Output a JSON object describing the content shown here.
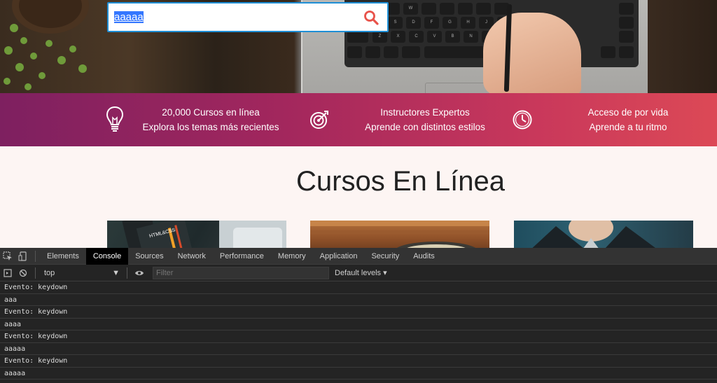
{
  "search": {
    "value": "aaaaa"
  },
  "features": [
    {
      "icon": "lightbulb-icon",
      "line1": "20,000 Cursos en línea",
      "line2": "Explora los temas más recientes"
    },
    {
      "icon": "target-icon",
      "line1": "Instructores Expertos",
      "line2": "Aprende con distintos estilos"
    },
    {
      "icon": "clock-icon",
      "line1": "Acceso de por vida",
      "line2": "Aprende a tu ritmo"
    }
  ],
  "courses": {
    "title": "Cursos En Línea",
    "card1_text": "HTML&CSS"
  },
  "devtools": {
    "tabs": [
      "Elements",
      "Console",
      "Sources",
      "Network",
      "Performance",
      "Memory",
      "Application",
      "Security",
      "Audits"
    ],
    "active_tab": "Console",
    "context": "top",
    "filter_placeholder": "Filter",
    "levels": "Default levels",
    "log": [
      "Evento: keydown",
      "aaa",
      "Evento: keydown",
      "aaaa",
      "Evento: keydown",
      "aaaaa",
      "Evento: keydown",
      "aaaaa"
    ]
  },
  "colors": {
    "accent": "#1f8fd6",
    "search_icon": "#e8524a",
    "gradient_start": "#7e2060",
    "gradient_end": "#dc4956"
  }
}
